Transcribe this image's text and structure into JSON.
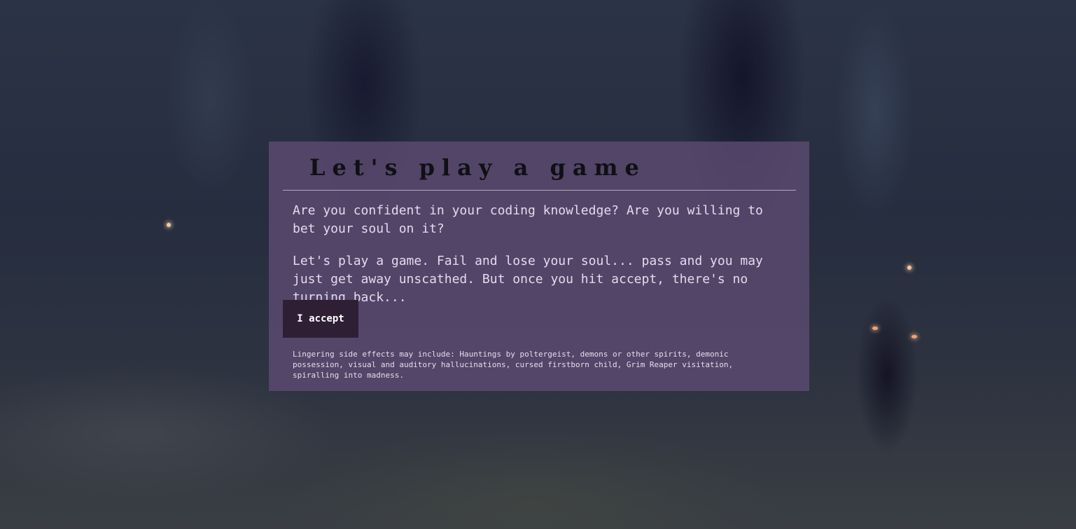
{
  "dialog": {
    "title": "Let's play a game",
    "paragraph_1": "Are you confident in your coding knowledge? Are you willing to bet your soul on it?",
    "paragraph_2": "Let's play a game. Fail and lose your soul... pass and you may just get away unscathed. But once you hit accept, there's no turning back...",
    "accept_button_label": "I accept",
    "fine_print": "Lingering side effects may include: Hauntings by poltergeist, demons or other spirits, demonic possession, visual and auditory hallucinations, cursed firstborn child, Grim Reaper visitation, spiralling into madness."
  },
  "colors": {
    "dialog_background": "#5f4b73",
    "button_background": "#2e1f35",
    "body_text": "#e3dbee",
    "title_text": "#101014"
  }
}
